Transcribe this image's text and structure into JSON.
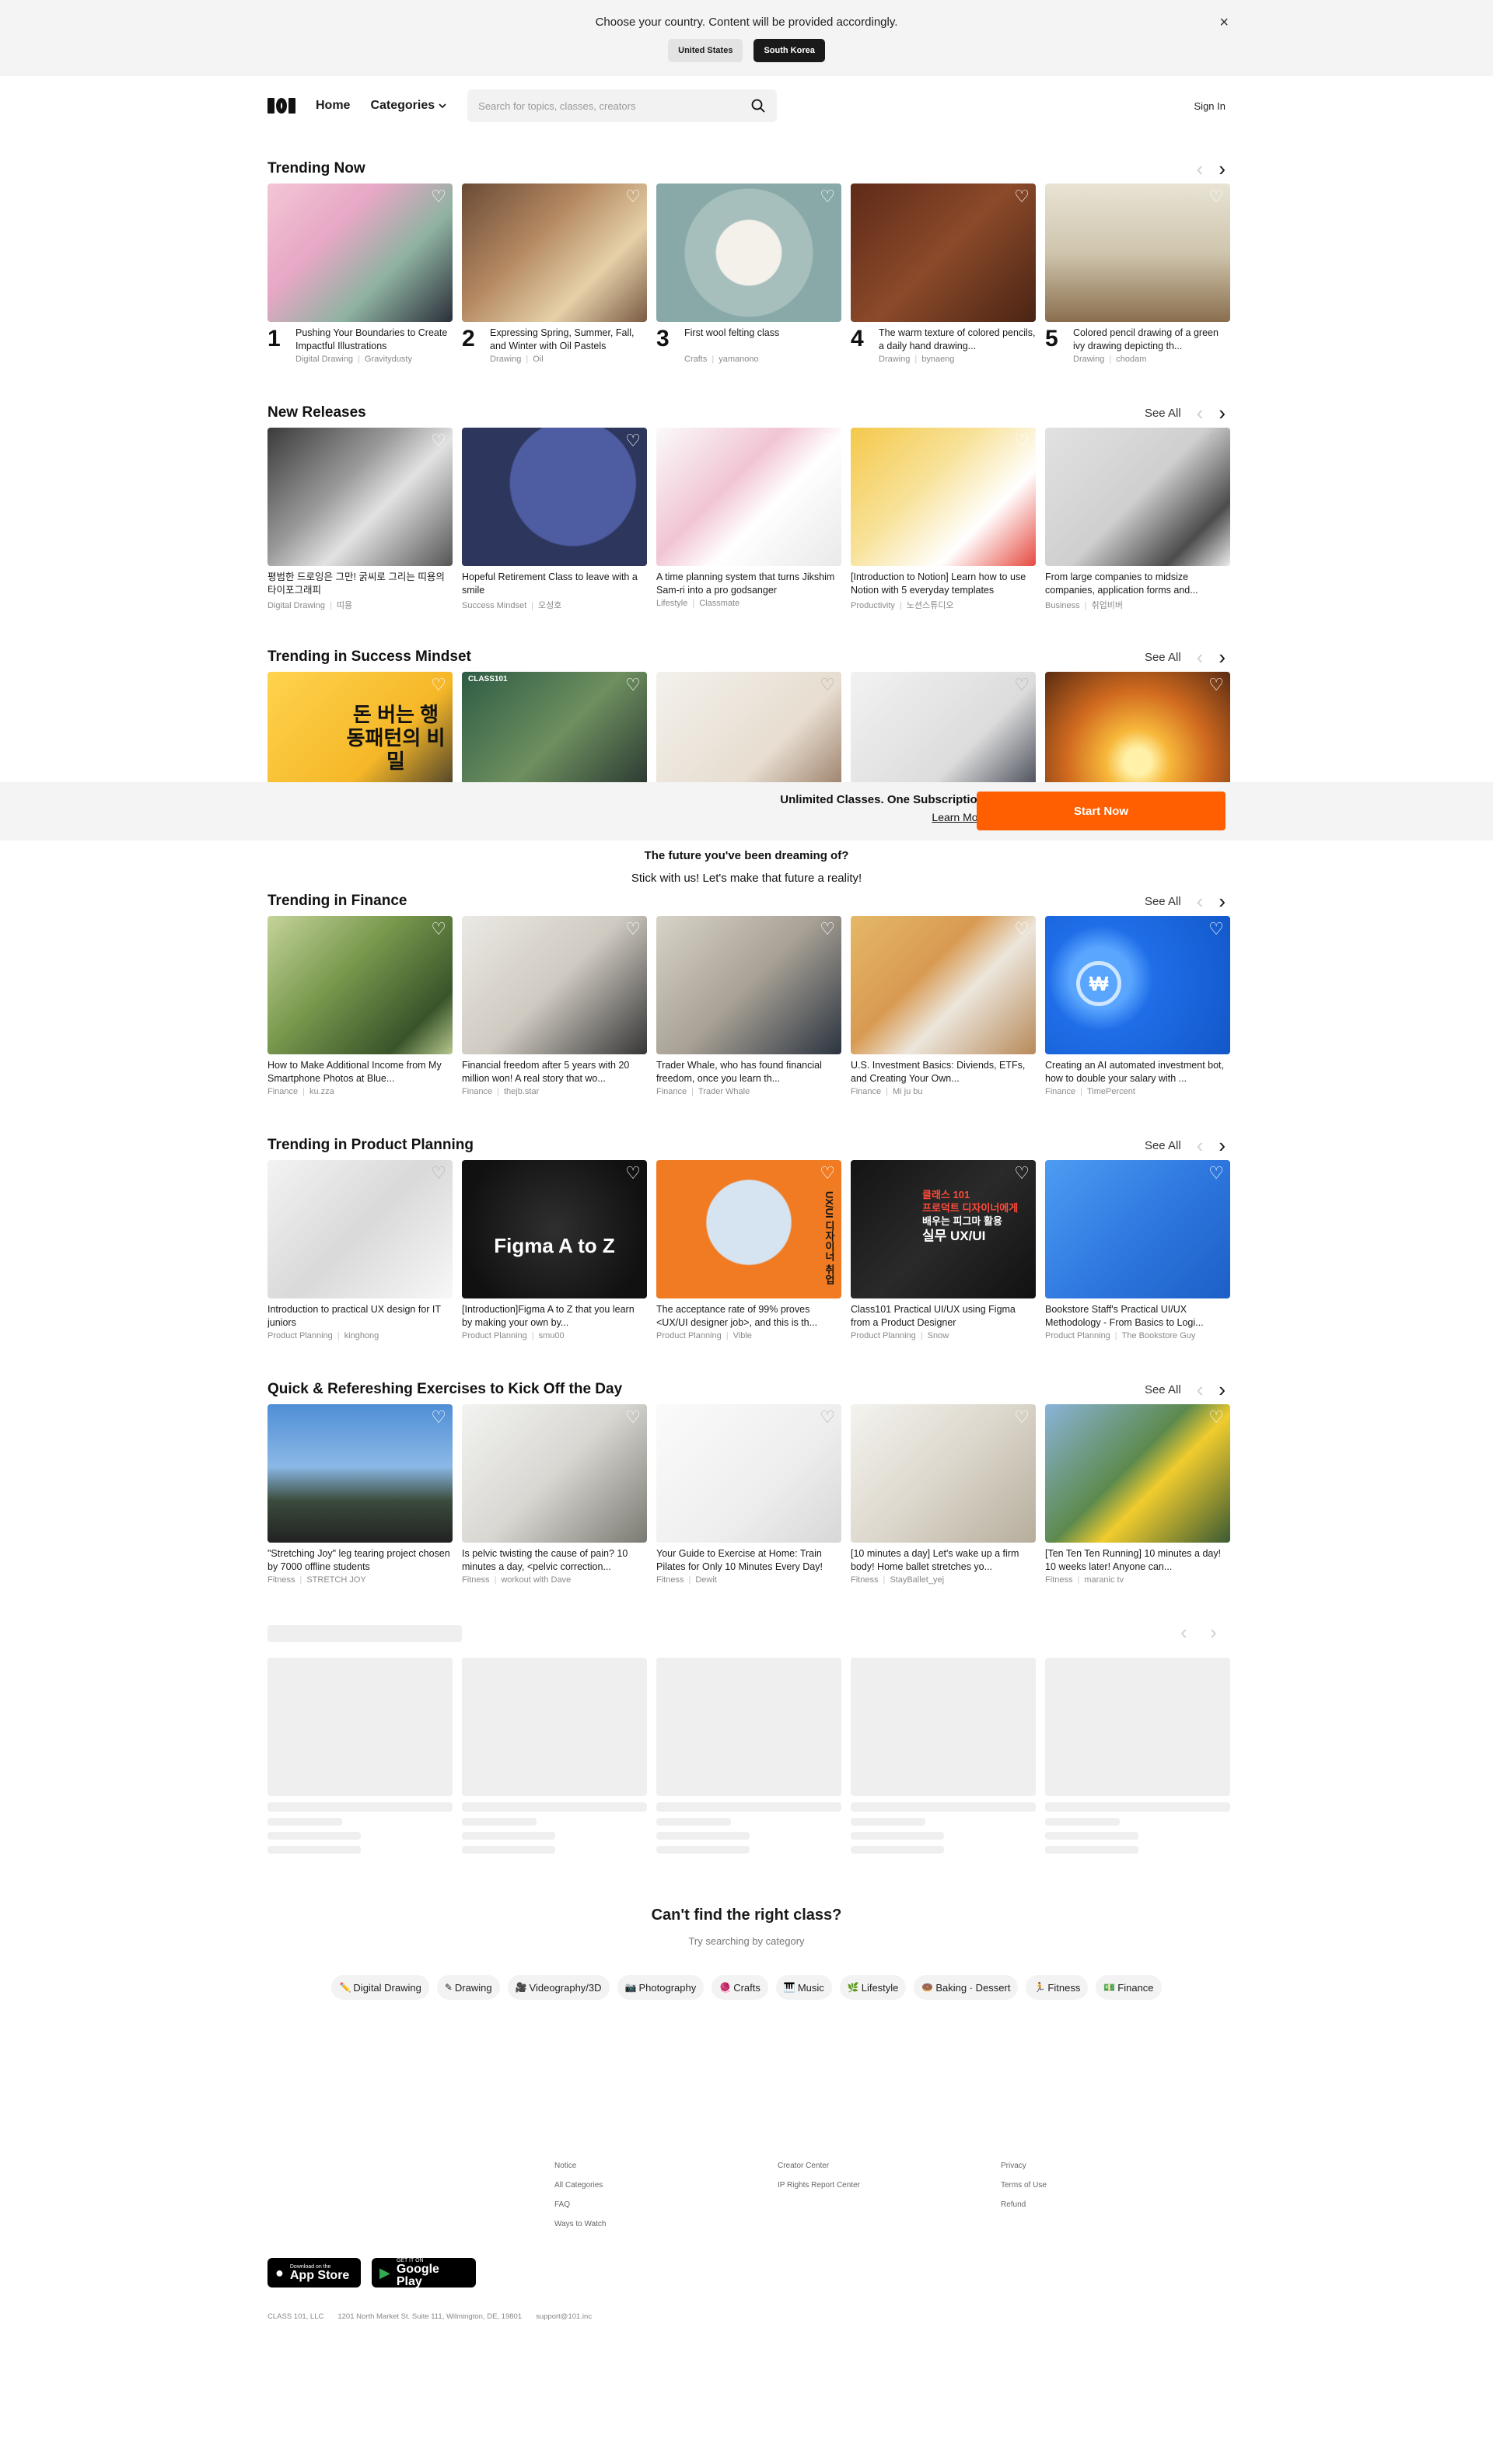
{
  "country_banner": {
    "message": "Choose your country. Content will be provided accordingly.",
    "options": [
      "United States",
      "South Korea"
    ],
    "selected": "South Korea",
    "close": "×"
  },
  "header": {
    "home": "Home",
    "categories": "Categories",
    "search_placeholder": "Search for topics, classes, creators",
    "sign_in": "Sign In"
  },
  "sections": [
    {
      "title": "Trending Now",
      "see_all": "",
      "cards": [
        {
          "rank": "1",
          "title": "Pushing Your Boundaries to Create Impactful Illustrations",
          "category": "Digital Drawing",
          "creator": "Gravitydusty"
        },
        {
          "rank": "2",
          "title": "Expressing Spring, Summer, Fall, and Winter with Oil Pastels",
          "category": "Drawing",
          "creator": "Oil"
        },
        {
          "rank": "3",
          "title": "First wool felting class",
          "category": "Crafts",
          "creator": "yamanono"
        },
        {
          "rank": "4",
          "title": "The warm texture of colored pencils, a daily hand drawing...",
          "category": "Drawing",
          "creator": "bynaeng"
        },
        {
          "rank": "5",
          "title": "Colored pencil drawing of a green ivy drawing depicting th...",
          "category": "Drawing",
          "creator": "chodam"
        }
      ]
    },
    {
      "title": "New Releases",
      "see_all": "See All",
      "cards": [
        {
          "title": "평범한 드로잉은 그만! 굵씨로 그리는 띠용의 타이포그래피",
          "category": "Digital Drawing",
          "creator": "띠용"
        },
        {
          "title": "Hopeful Retirement Class to leave with a smile",
          "category": "Success Mindset",
          "creator": "오성호"
        },
        {
          "title": "A time planning system that turns Jikshim Sam-ri into a pro godsanger",
          "category": "Lifestyle",
          "creator": "Classmate"
        },
        {
          "title": "[Introduction to Notion] Learn how to use Notion with 5 everyday templates",
          "category": "Productivity",
          "creator": "노션스튜디오"
        },
        {
          "title": "From large companies to midsize companies, application forms and...",
          "category": "Business",
          "creator": "취업비버"
        }
      ]
    },
    {
      "title": "Trending in Success Mindset",
      "see_all": "See All",
      "overlays": [
        "돈 버는 행동패턴의 비밀",
        "CLASS101"
      ]
    },
    {
      "title": "Trending in Finance",
      "see_all": "See All",
      "cards": [
        {
          "title": "How to Make Additional Income from My Smartphone Photos at Blue...",
          "category": "Finance",
          "creator": "ku.zza"
        },
        {
          "title": "Financial freedom after 5 years with 20 million won! A real story that wo...",
          "category": "Finance",
          "creator": "thejb.star"
        },
        {
          "title": "Trader Whale, who has found financial freedom, once you learn th...",
          "category": "Finance",
          "creator": "Trader Whale"
        },
        {
          "title": "U.S. Investment Basics: Diviends, ETFs, and Creating Your Own...",
          "category": "Finance",
          "creator": "Mi ju bu"
        },
        {
          "title": "Creating an AI automated investment bot, how to double your salary with ...",
          "category": "Finance",
          "creator": "TimePercent"
        }
      ]
    },
    {
      "title": "Trending in Product Planning",
      "see_all": "See All",
      "cards": [
        {
          "title": "Introduction to practical UX design for IT juniors",
          "category": "Product Planning",
          "creator": "kinghong"
        },
        {
          "title": "[Introduction]Figma A to Z that you learn by making your own by...",
          "category": "Product Planning",
          "creator": "smu00"
        },
        {
          "title": "The acceptance rate of 99% proves <UX/UI designer job>, and this is th...",
          "category": "Product Planning",
          "creator": "Vible"
        },
        {
          "title": "Class101 Practical UI/UX using Figma from a Product Designer",
          "category": "Product Planning",
          "creator": "Snow"
        },
        {
          "title": "Bookstore Staff's Practical UI/UX Methodology - From Basics to Logi...",
          "category": "Product Planning",
          "creator": "The Bookstore Guy"
        }
      ],
      "overlays": [
        "Figma A to Z",
        "클래스 101",
        "프로덕트 디자이너에게",
        "배우는 피그마 활용",
        "실무 UX/UI",
        "UX/UI 디자이너 취업"
      ]
    },
    {
      "title": "Quick & Refereshing Exercises to Kick Off the Day",
      "see_all": "See All",
      "cards": [
        {
          "title": "\"Stretching Joy\" leg tearing project chosen by 7000 offline students",
          "category": "Fitness",
          "creator": "STRETCH JOY"
        },
        {
          "title": "Is pelvic twisting the cause of pain? 10 minutes a day, <pelvic correction...",
          "category": "Fitness",
          "creator": "workout with Dave"
        },
        {
          "title": "Your Guide to Exercise at Home: Train Pilates for Only 10 Minutes Every Day!",
          "category": "Fitness",
          "creator": "Dewit"
        },
        {
          "title": "[10 minutes a day] Let's wake up a firm body! Home ballet stretches yo...",
          "category": "Fitness",
          "creator": "StayBallet_yej"
        },
        {
          "title": "[Ten Ten Ten Running] 10 minutes a day! 10 weeks later! Anyone can...",
          "category": "Fitness",
          "creator": "maranic tv"
        }
      ]
    }
  ],
  "subscription": {
    "title": "Unlimited Classes. One Subscription.",
    "learn_more": "Learn More",
    "cta": "Start Now",
    "future_line1": "The future you've been dreaming of?",
    "future_line2": "Stick with us! Let's make that future a reality!"
  },
  "category_search": {
    "title": "Can't find the right class?",
    "subtitle": "Try searching by category",
    "chips": [
      {
        "icon": "✏️",
        "label": "Digital Drawing"
      },
      {
        "icon": "✎",
        "label": "Drawing"
      },
      {
        "icon": "🎥",
        "label": "Videography/3D"
      },
      {
        "icon": "📷",
        "label": "Photography"
      },
      {
        "icon": "🧶",
        "label": "Crafts"
      },
      {
        "icon": "🎹",
        "label": "Music"
      },
      {
        "icon": "🌿",
        "label": "Lifestyle"
      },
      {
        "icon": "🍩",
        "label": "Baking · Dessert"
      },
      {
        "icon": "🏃",
        "label": "Fitness"
      },
      {
        "icon": "💵",
        "label": "Finance"
      }
    ]
  },
  "footer": {
    "col1": [
      "Notice",
      "All Categories",
      "FAQ",
      "Ways to Watch"
    ],
    "col2": [
      "Creator Center",
      "IP Rights Report Center"
    ],
    "col3": [
      "Privacy",
      "Terms of Use",
      "Refund"
    ],
    "app_store": {
      "small": "Download on the",
      "big": "App Store"
    },
    "google_play": {
      "small": "GET IT ON",
      "big": "Google Play"
    },
    "company": "CLASS 101, LLC",
    "address": "1201 North Market St. Suite 111, Wilmington, DE, 19801",
    "email": "support@101.inc"
  },
  "colors": {
    "accent": "#ff5f00",
    "text": "#1a1a1a",
    "muted": "#8a8a8a",
    "banner_bg": "#f4f4f4"
  },
  "icons": {
    "close": "close-icon",
    "search": "search-icon",
    "heart": "heart-icon",
    "chevron_left": "chevron-left-icon",
    "chevron_right": "chevron-right-icon",
    "chevron_down": "chevron-down-icon"
  }
}
